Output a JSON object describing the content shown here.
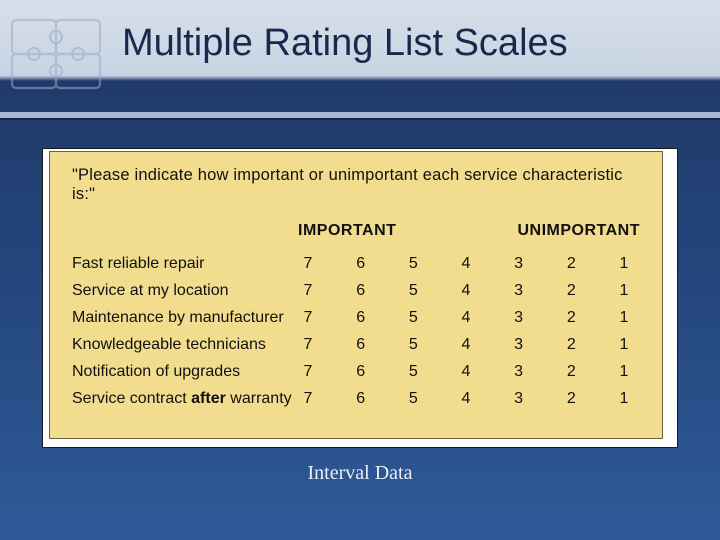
{
  "title": "Multiple Rating List Scales",
  "footer": "Interval Data",
  "panel": {
    "prompt": "\"Please indicate how important or unimportant each service characteristic is:\"",
    "left_header": "IMPORTANT",
    "right_header": "UNIMPORTANT",
    "scale": [
      "7",
      "6",
      "5",
      "4",
      "3",
      "2",
      "1"
    ],
    "items": [
      {
        "label": "Fast reliable repair",
        "bold": ""
      },
      {
        "label": "Service at my location",
        "bold": ""
      },
      {
        "label": "Maintenance by manufacturer",
        "bold": ""
      },
      {
        "label": "Knowledgeable technicians",
        "bold": ""
      },
      {
        "label": "Notification of upgrades",
        "bold": ""
      },
      {
        "label_prefix": "Service contract ",
        "bold": "after",
        "label_suffix": " warranty"
      }
    ]
  }
}
